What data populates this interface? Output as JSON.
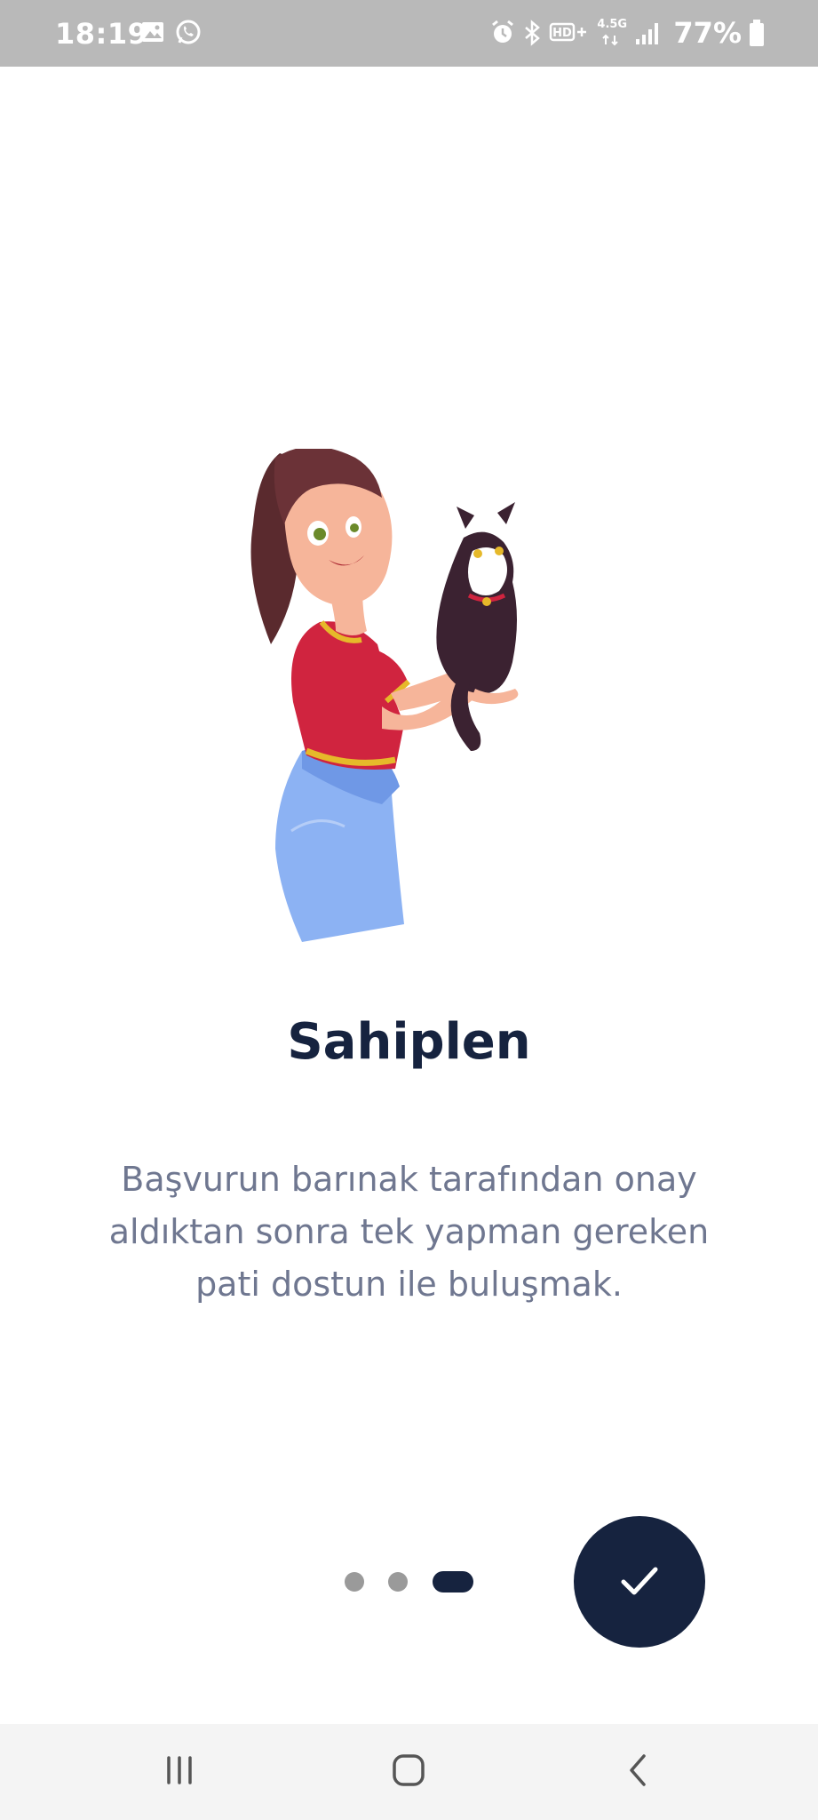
{
  "status_bar": {
    "time": "18:19",
    "battery_percent": "77%",
    "network_label": "4.5G",
    "left_icons": [
      "gallery-icon",
      "whatsapp-icon"
    ],
    "right_icons": [
      "alarm-icon",
      "bluetooth-icon",
      "hd-voice-icon",
      "network-4-5g-icon",
      "signal-icon",
      "battery-icon"
    ]
  },
  "onboarding": {
    "title": "Sahiplen",
    "description": "Başvurun barınak tarafından onay aldıktan sonra tek yapman gereken pati dostun ile buluşmak.",
    "illustration": "woman-holding-cat-illustration",
    "page_count": 3,
    "active_page": 3,
    "done_button_icon": "check-icon"
  },
  "nav_bar": {
    "icons": [
      "recent-apps-icon",
      "home-icon",
      "back-icon"
    ]
  },
  "colors": {
    "primary": "#16233f",
    "text_secondary": "#6f7790",
    "status_bar": "#b9b9b9",
    "inactive_dot": "#9a9a9a"
  }
}
